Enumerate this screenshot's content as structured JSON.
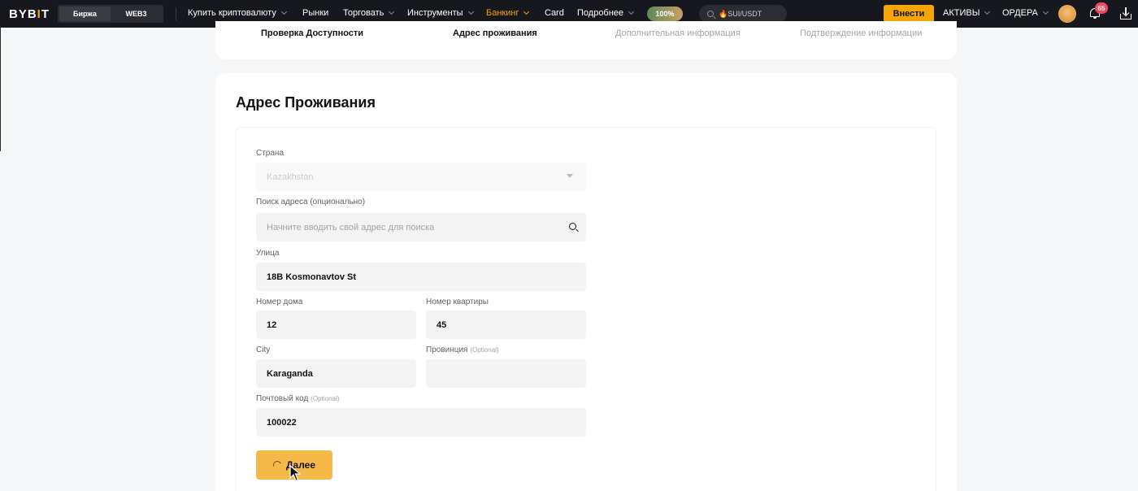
{
  "header": {
    "logo": "BYB",
    "logo_mark": "I",
    "logo_end": "T",
    "segments": [
      "Биржа",
      "WEB3"
    ],
    "nav": [
      {
        "label": "Купить криптовалюту"
      },
      {
        "label": "Рынки"
      },
      {
        "label": "Торговать"
      },
      {
        "label": "Инструменты"
      },
      {
        "label": "Банкинг"
      },
      {
        "label": "Card"
      },
      {
        "label": "Подробнее"
      }
    ],
    "promo_badge": "100%",
    "search_text": "🔥SUI/USDT",
    "deposit_label": "Внести",
    "assets_label": "АКТИВЫ",
    "orders_label": "ОРДЕРА",
    "notifications_count": "65",
    "accent_color": "#f7a600"
  },
  "steps": [
    {
      "label": "Проверка Доступности",
      "state": "done"
    },
    {
      "label": "Адрес проживания",
      "state": "current"
    },
    {
      "label": "Дополнительная информация",
      "state": "pending"
    },
    {
      "label": "Подтверждение информации",
      "state": "pending"
    }
  ],
  "form": {
    "title": "Адрес Проживания",
    "country": {
      "label": "Страна",
      "value": "Kazakhstan"
    },
    "address_search": {
      "label": "Поиск адреса (опционально)",
      "placeholder": "Начните вводить свой адрес для поиска"
    },
    "street": {
      "label": "Улица",
      "value": "18B Kosmonavtov St"
    },
    "house": {
      "label": "Номер дома",
      "value": "12"
    },
    "apartment": {
      "label": "Номер квартиры",
      "value": "45"
    },
    "city": {
      "label": "City",
      "value": "Karaganda"
    },
    "province": {
      "label": "Провинция",
      "optional": "(Optional)",
      "value": ""
    },
    "postal": {
      "label": "Почтовый код",
      "optional": "(Optional)",
      "value": "100022"
    },
    "next_label": "Далее"
  }
}
